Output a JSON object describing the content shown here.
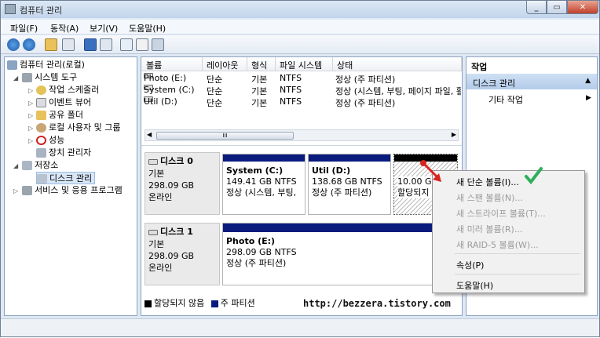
{
  "window": {
    "title": "컴퓨터 관리"
  },
  "menu": [
    "파일(F)",
    "동작(A)",
    "보기(V)",
    "도움말(H)"
  ],
  "tree": {
    "root": "컴퓨터 관리(로컬)",
    "system_tools": "시스템 도구",
    "task_scheduler": "작업 스케줄러",
    "event_viewer": "이벤트 뷰어",
    "shared_folders": "공유 폴더",
    "local_users": "로컬 사용자 및 그룹",
    "performance": "성능",
    "device_manager": "장치 관리자",
    "storage": "저장소",
    "disk_management": "디스크 관리",
    "services": "서비스 및 응용 프로그램"
  },
  "list": {
    "headers": [
      "볼륨",
      "레이아웃",
      "형식",
      "파일 시스템",
      "상태"
    ],
    "rows": [
      [
        "Photo (E:)",
        "단순",
        "기본",
        "NTFS",
        "정상 (주 파티션)"
      ],
      [
        "System (C:)",
        "단순",
        "기본",
        "NTFS",
        "정상 (시스템, 부팅, 페이지 파일, 활"
      ],
      [
        "Util (D:)",
        "단순",
        "기본",
        "NTFS",
        "정상 (주 파티션)"
      ]
    ],
    "scroll_label": "III"
  },
  "disks": [
    {
      "name": "디스크 0",
      "type": "기본",
      "size": "298.09 GB",
      "status": "온라인",
      "parts": [
        {
          "name": "System  (C:)",
          "size": "149.41 GB NTFS",
          "status": "정상 (시스템, 부팅,"
        },
        {
          "name": "Util  (D:)",
          "size": "138.68 GB NTFS",
          "status": "정상 (주 파티션)"
        },
        {
          "name": "",
          "size": "10.00 GB",
          "status": "할당되지"
        }
      ]
    },
    {
      "name": "디스크 1",
      "type": "기본",
      "size": "298.09 GB",
      "status": "온라인",
      "parts": [
        {
          "name": "Photo  (E:)",
          "size": "298.09 GB NTFS",
          "status": "정상 (주 파티션)"
        }
      ]
    }
  ],
  "legend": {
    "unallocated": "할당되지 않음",
    "primary": "주 파티션"
  },
  "actions": {
    "header": "작업",
    "section": "디스크 관리",
    "more": "기타 작업"
  },
  "context_menu": {
    "new_simple": "새 단순 볼륨(I)...",
    "new_spanned": "새 스팬 볼륨(N)...",
    "new_striped": "새 스트라이프 볼륨(T)...",
    "new_mirror": "새 미러 볼륨(R)...",
    "new_raid5": "새 RAID-5 볼륨(W)...",
    "properties": "속성(P)",
    "help": "도움말(H)"
  },
  "watermark": "http://bezzera.tistory.com",
  "colors": {
    "primary_partition": "#0a1b7e",
    "unallocated": "#000000",
    "check": "#2fae5a",
    "arrow": "#d8231f"
  }
}
